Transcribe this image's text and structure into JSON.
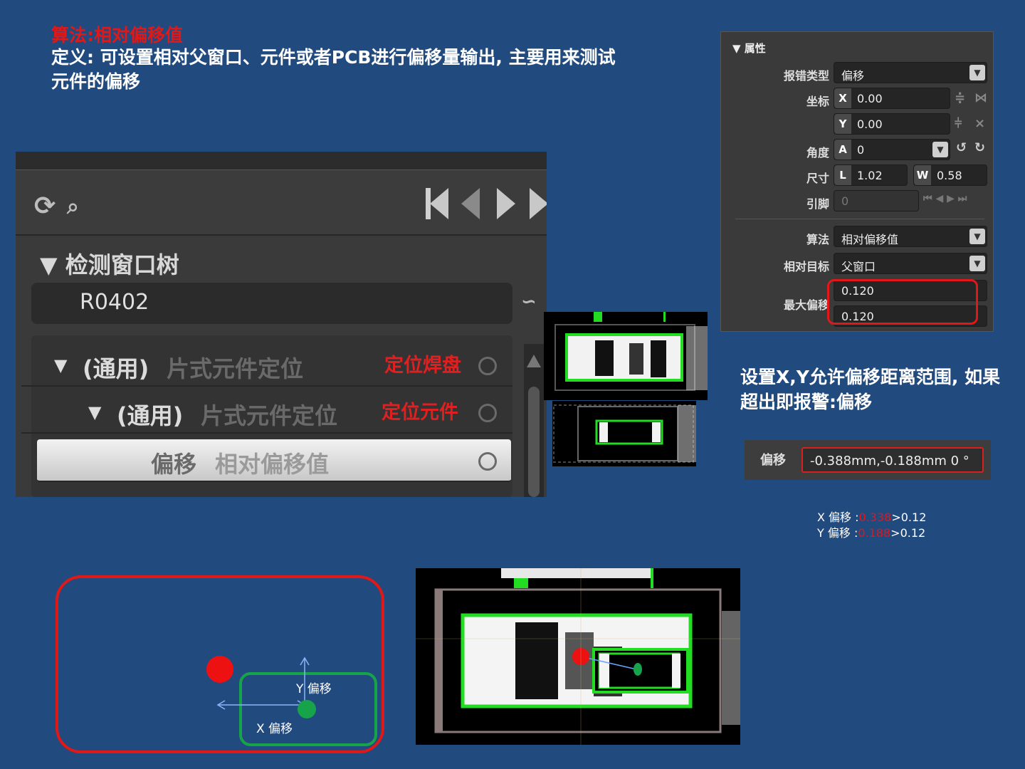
{
  "title": "算法:相对偏移值",
  "definition": "定义: 可设置相对父窗口、元件或者PCB进行偏移量输出, 主要用来测试元件的偏移",
  "tree_panel": {
    "header": "▼ 检测窗口树",
    "search_value": "R0402",
    "rows": [
      {
        "twisty": "▼",
        "tag": "(通用)",
        "desc": "片式元件定位",
        "note": "定位焊盘"
      },
      {
        "twisty": "▼",
        "tag": "(通用)",
        "desc": "片式元件定位",
        "note": "定位元件"
      },
      {
        "twisty": "",
        "tag": "偏移",
        "desc": "相对偏移值",
        "note": ""
      }
    ]
  },
  "properties": {
    "header": "▼ 属性",
    "error_type_label": "报错类型",
    "error_type_value": "偏移",
    "coord_label": "坐标",
    "x_prefix": "X",
    "x_value": "0.00",
    "y_prefix": "Y",
    "y_value": "0.00",
    "angle_label": "角度",
    "angle_prefix": "A",
    "angle_value": "0",
    "size_label": "尺寸",
    "l_prefix": "L",
    "l_value": "1.02",
    "w_prefix": "W",
    "w_value": "0.58",
    "pin_label": "引脚",
    "pin_value": "0",
    "algo_label": "算法",
    "algo_value": "相对偏移值",
    "relative_target_label": "相对目标",
    "relative_target_value": "父窗口",
    "max_offset_label": "最大偏移",
    "max_offset_x": "0.120",
    "max_offset_y": "0.120"
  },
  "right_description": "设置X,Y允许偏移距离范围, 如果超出即报警:偏移",
  "offset_result": {
    "label": "偏移",
    "value": "-0.388mm,-0.188mm 0 °"
  },
  "calc": {
    "x_label": "X 偏移 :",
    "x_value": "0.338",
    "x_cmp": ">0.12",
    "y_label": "Y 偏移 :",
    "y_value": "0.188",
    "y_cmp": ">0.12"
  },
  "diagram": {
    "y_label": "Y 偏移",
    "x_label": "X 偏移"
  },
  "colors": {
    "background": "#214a7f",
    "alert_red": "#e01818",
    "inspect_green": "#16a34a",
    "box_green": "#22dd22"
  }
}
